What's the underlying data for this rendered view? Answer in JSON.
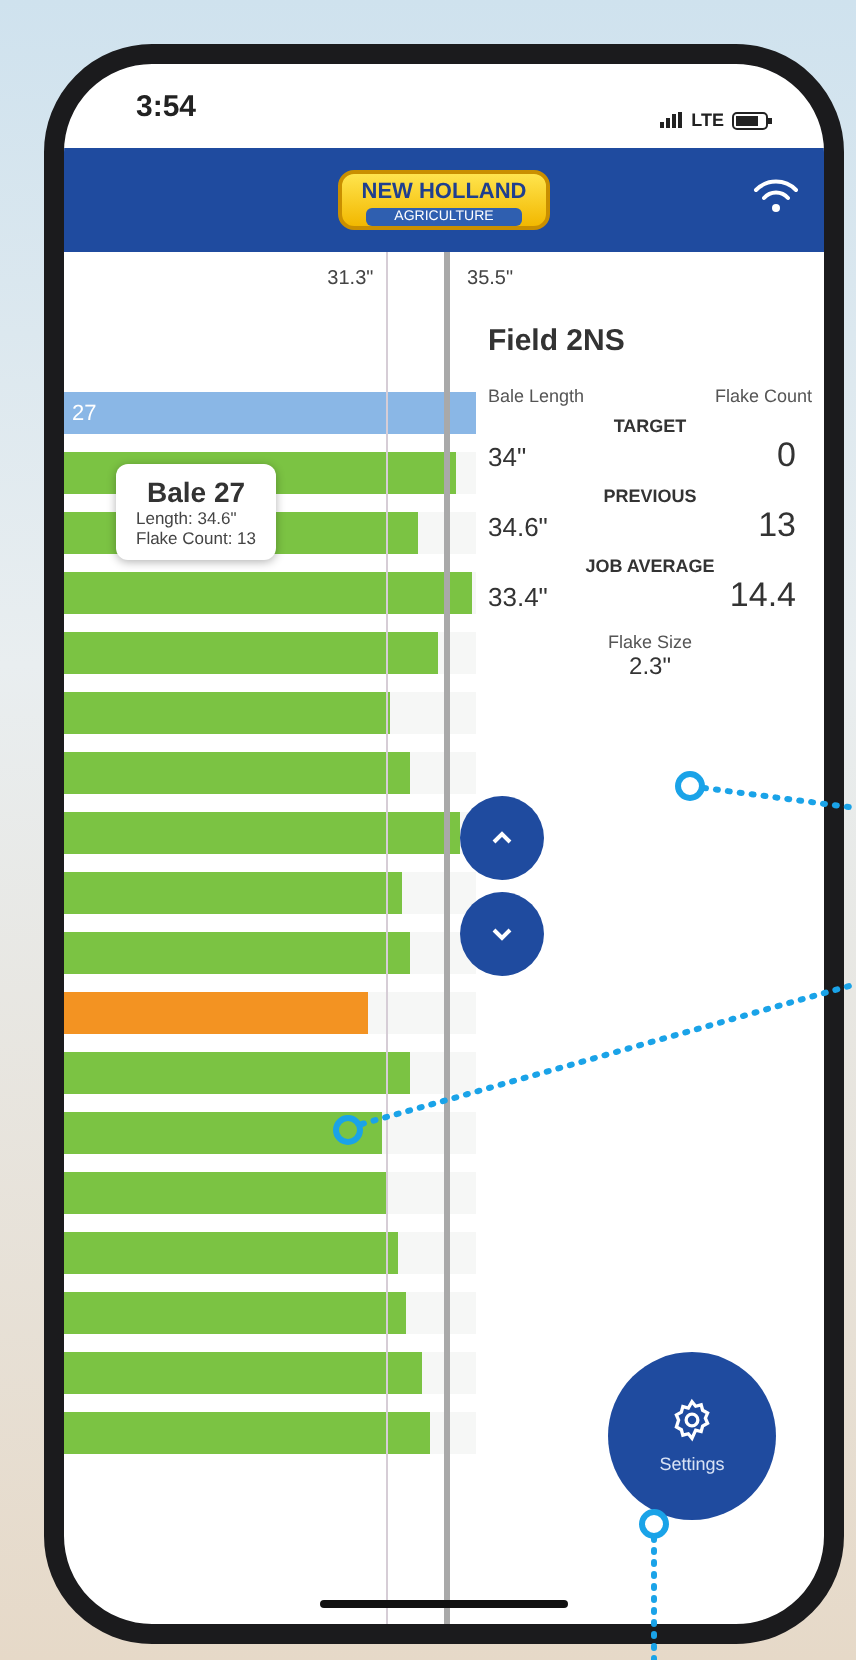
{
  "status_bar": {
    "time": "3:54",
    "network": "LTE"
  },
  "header": {
    "logo_top": "NEW HOLLAND",
    "logo_bottom": "AGRICULTURE"
  },
  "chart": {
    "reference_lines": [
      {
        "label": "31.3\"",
        "level": 0.78,
        "kind": "thin"
      },
      {
        "label": "35.5\"",
        "level": 0.92,
        "kind": "thick"
      }
    ],
    "bars": [
      {
        "label": "27",
        "level": 1,
        "kind": "current"
      },
      {
        "level": 0.95,
        "kind": "normal"
      },
      {
        "level": 0.86,
        "kind": "normal"
      },
      {
        "level": 0.99,
        "kind": "normal"
      },
      {
        "level": 0.91,
        "kind": "normal"
      },
      {
        "level": 0.79,
        "kind": "normal"
      },
      {
        "level": 0.84,
        "kind": "normal"
      },
      {
        "level": 0.96,
        "kind": "normal"
      },
      {
        "level": 0.82,
        "kind": "normal"
      },
      {
        "level": 0.84,
        "kind": "normal"
      },
      {
        "level": 0.74,
        "kind": "flagged"
      },
      {
        "level": 0.84,
        "kind": "normal"
      },
      {
        "level": 0.77,
        "kind": "normal"
      },
      {
        "level": 0.78,
        "kind": "normal"
      },
      {
        "level": 0.81,
        "kind": "normal"
      },
      {
        "level": 0.83,
        "kind": "normal"
      },
      {
        "level": 0.87,
        "kind": "normal"
      },
      {
        "level": 0.89,
        "kind": "normal"
      }
    ],
    "tooltip": {
      "title": "Bale 27",
      "lines": [
        "Length: 34.6\"",
        "Flake Count: 13"
      ]
    }
  },
  "panel": {
    "field": "Field 2NS",
    "column_labels": [
      "Bale Length",
      "Flake Count"
    ],
    "stats": [
      {
        "title": "TARGET",
        "length": "34\"",
        "count": "0"
      },
      {
        "title": "PREVIOUS",
        "length": "34.6\"",
        "count": "13"
      },
      {
        "title": "JOB AVERAGE",
        "length": "33.4\"",
        "count": "14.4"
      }
    ],
    "flake_size": {
      "label": "Flake Size",
      "value": "2.3\""
    }
  },
  "settings_button": {
    "label": "Settings"
  }
}
